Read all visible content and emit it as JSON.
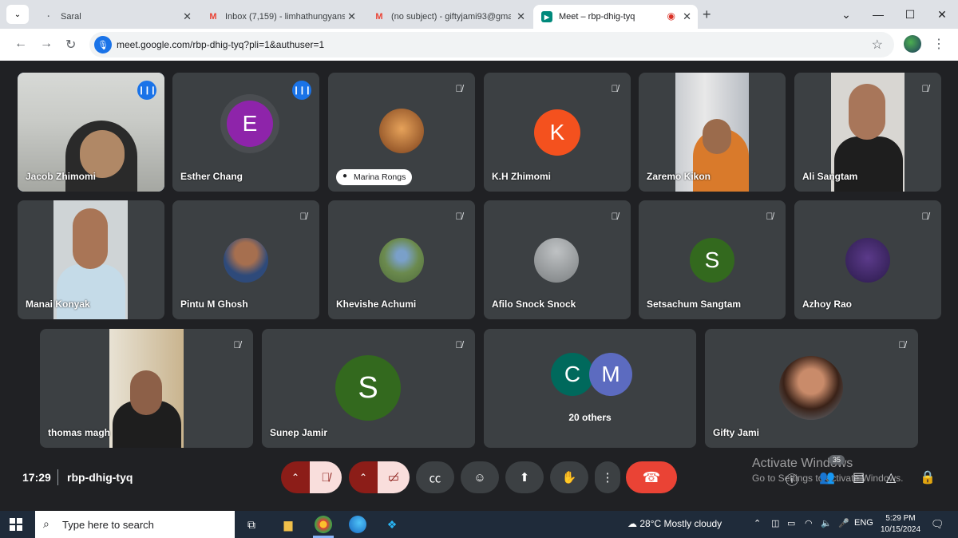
{
  "browser": {
    "tabs": [
      {
        "label": "Saral",
        "icon": "globe-icon"
      },
      {
        "label": "Inbox (7,159) - limhathungyans",
        "icon": "gmail-icon"
      },
      {
        "label": "(no subject) - giftyjami93@gma",
        "icon": "gmail-icon"
      },
      {
        "label": "Meet – rbp-dhig-tyq",
        "icon": "meet-icon"
      }
    ],
    "url": "meet.google.com/rbp-dhig-tyq?pli=1&authuser=1"
  },
  "participants": [
    {
      "name": "Jacob Zhimomi",
      "status": "speaking",
      "video": true
    },
    {
      "name": "Esther Chang",
      "status": "speaking",
      "initial": "E",
      "color": "#8e24aa"
    },
    {
      "name": "Marina Rongs",
      "status": "muted",
      "video": false
    },
    {
      "name": "K.H Zhimomi",
      "status": "muted",
      "initial": "K",
      "color": "#f4511e"
    },
    {
      "name": "Zaremo Kikon",
      "status": "none",
      "video": true
    },
    {
      "name": "Ali Sangtam",
      "status": "muted",
      "video": true
    },
    {
      "name": "Manai Konyak",
      "status": "none",
      "video": true
    },
    {
      "name": "Pintu M Ghosh",
      "status": "muted",
      "video": false
    },
    {
      "name": "Khevishe Achumi",
      "status": "muted",
      "video": false
    },
    {
      "name": "Afilo Snock Snock",
      "status": "muted",
      "video": false
    },
    {
      "name": "Setsachum Sangtam",
      "status": "muted",
      "initial": "S",
      "color": "#33691e"
    },
    {
      "name": "Azhoy Rao",
      "status": "muted",
      "video": false
    },
    {
      "name": "thomas magh",
      "status": "muted",
      "video": true
    },
    {
      "name": "Sunep Jamir",
      "status": "muted",
      "initial": "S",
      "color": "#33691e"
    },
    {
      "name": "Gifty Jami",
      "status": "muted",
      "video": false
    }
  ],
  "others": {
    "initials": [
      "C",
      "M"
    ],
    "label": "20 others",
    "colors": [
      "#00695c",
      "#5c6bc0"
    ]
  },
  "meeting": {
    "time": "17:29",
    "separator": "|",
    "code": "rbp-dhig-tyq",
    "people_count": "35"
  },
  "watermark": {
    "line1": "Activate Windows",
    "line2": "Go to Settings to activate Windows."
  },
  "taskbar": {
    "search_placeholder": "Type here to search",
    "weather": "28°C  Mostly cloudy",
    "lang": "ENG",
    "time": "5:29 PM",
    "date": "10/15/2024"
  }
}
